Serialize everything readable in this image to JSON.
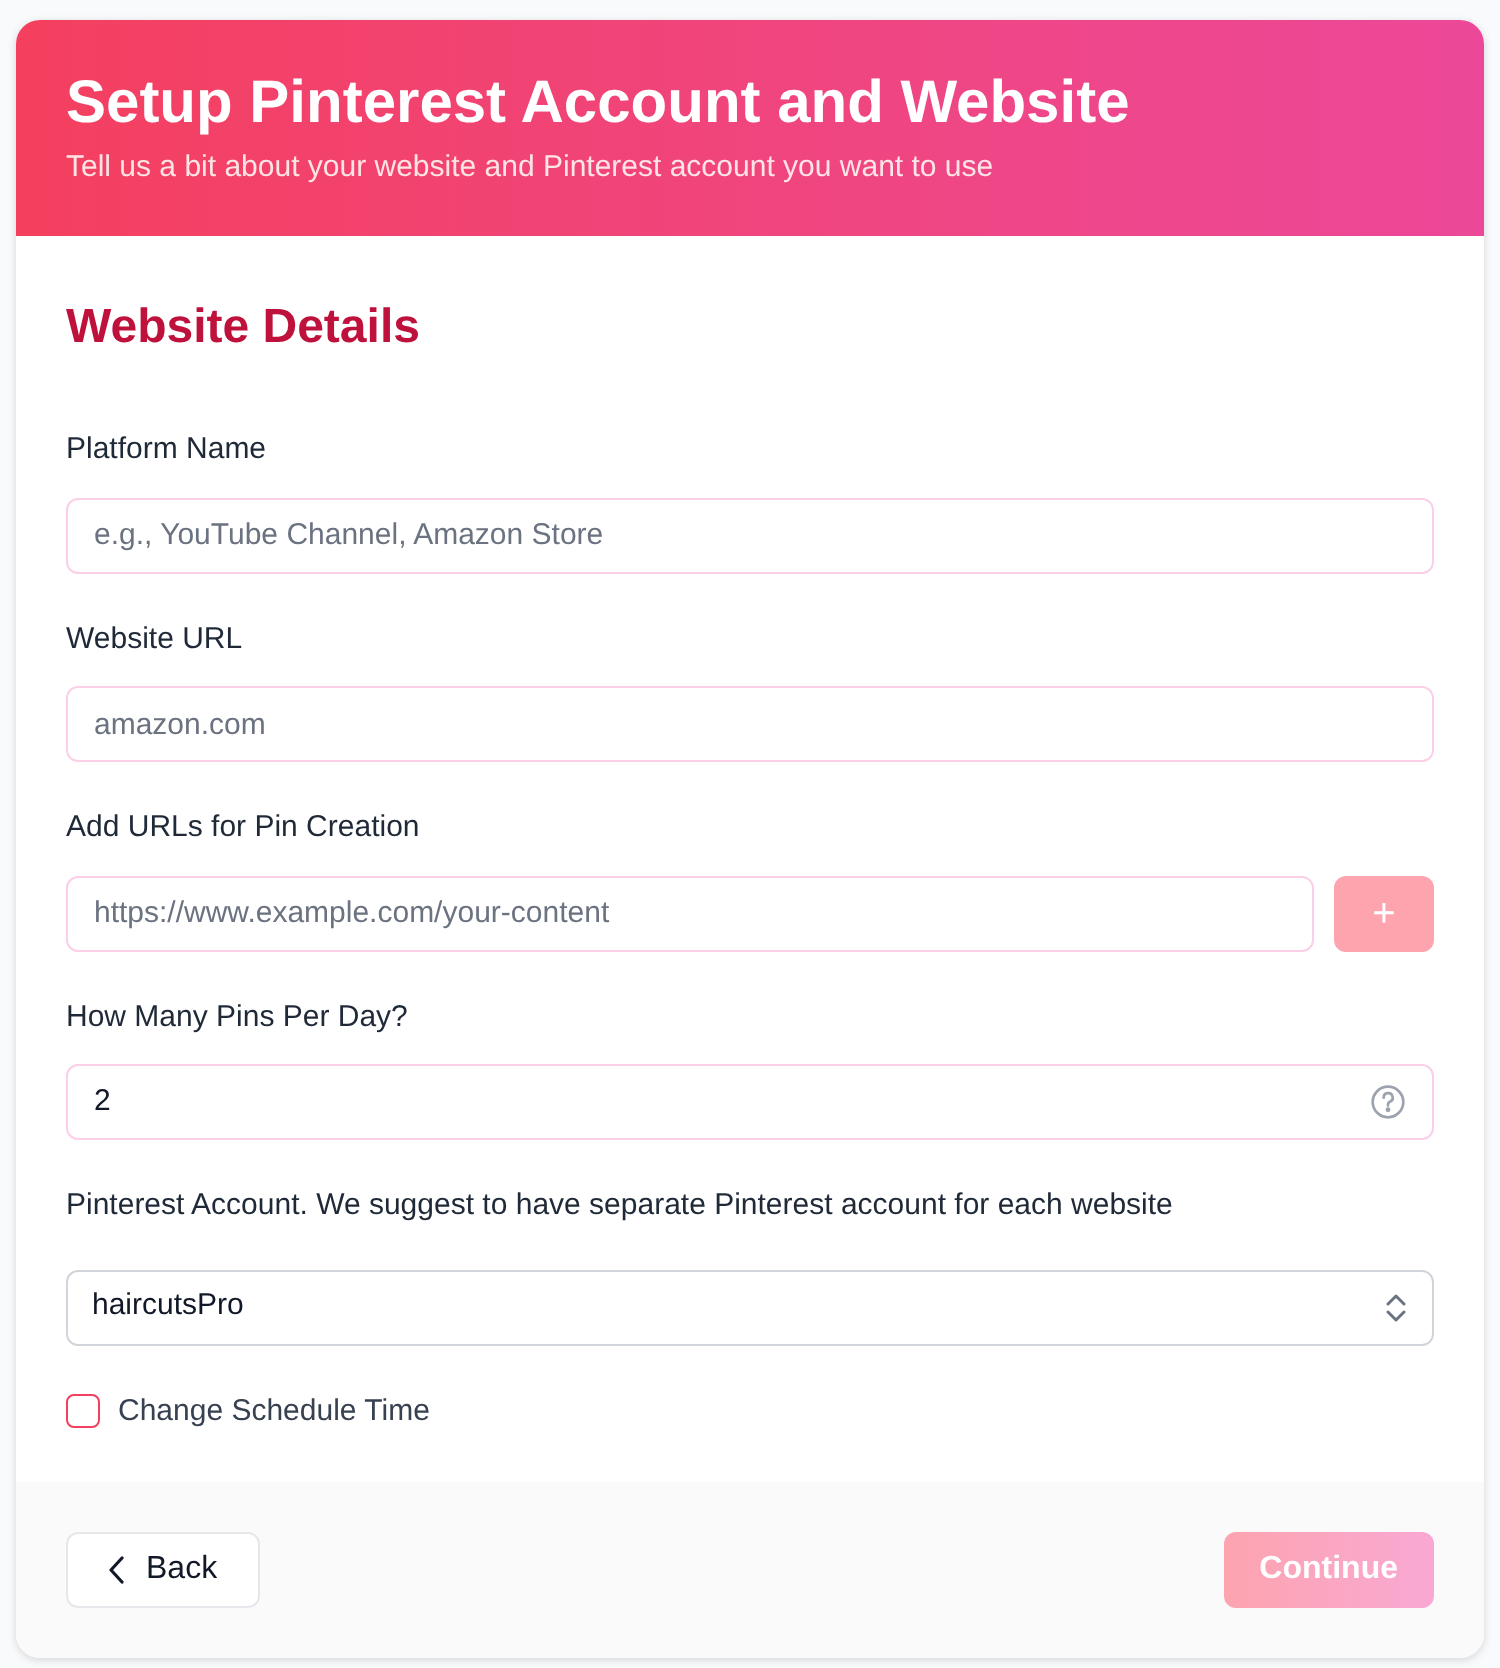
{
  "header": {
    "title": "Setup Pinterest Account and Website",
    "subtitle": "Tell us a bit about your website and Pinterest account you want to use"
  },
  "section_title": "Website Details",
  "fields": [
    {
      "kind": "text",
      "label": "Platform Name",
      "placeholder": "e.g., YouTube Channel, Amazon Store"
    },
    {
      "kind": "text",
      "label": "Website URL",
      "placeholder": "amazon.com"
    },
    {
      "kind": "add",
      "label": "Add URLs for Pin Creation",
      "placeholder": "https://www.example.com/your-content",
      "button": {
        "label": "+",
        "disabled": true
      }
    },
    {
      "kind": "help",
      "label": "How Many Pins Per Day?",
      "value": "2"
    },
    {
      "kind": "select",
      "label": "Pinterest Account. We suggest to have separate Pinterest account for each website",
      "value": "haircutsPro"
    }
  ],
  "checkbox": {
    "label": "Change Schedule Time",
    "checked": false
  },
  "footer": {
    "back": {
      "label": "Back"
    },
    "continue": {
      "label": "Continue",
      "disabled": true
    }
  }
}
